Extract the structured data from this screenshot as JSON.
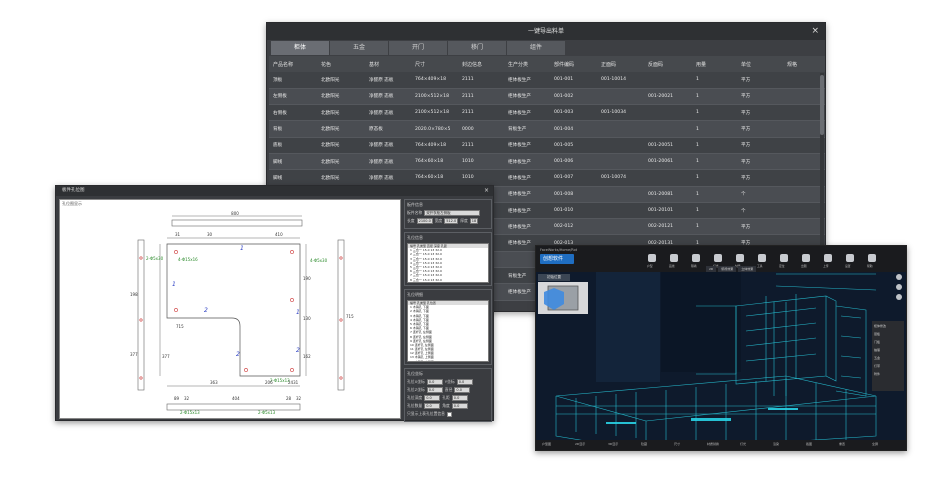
{
  "bom_window": {
    "title": "一键导出料单",
    "close": "×",
    "tabs": [
      "柜体",
      "五金",
      "开门",
      "移门",
      "组件"
    ],
    "columns": [
      "产品名称",
      "花色",
      "基材",
      "尺寸",
      "封边信息",
      "生产分类",
      "部件编码",
      "正面码",
      "反面码",
      "用量",
      "单位",
      "规格"
    ],
    "rows": [
      [
        "顶板",
        "北欧阳光",
        "净醛原 态板",
        "764×409×18",
        "2111",
        "柜体板生产",
        "001-001",
        "001-10014",
        "",
        "1",
        "平方",
        ""
      ],
      [
        "左侧板",
        "北欧阳光",
        "净醛原 态板",
        "2100×512×18",
        "2111",
        "柜体板生产",
        "001-002",
        "",
        "001-20021",
        "1",
        "平方",
        ""
      ],
      [
        "右侧板",
        "北欧阳光",
        "净醛原 态板",
        "2100×512×18",
        "2111",
        "柜体板生产",
        "001-003",
        "001-10034",
        "",
        "1",
        "平方",
        ""
      ],
      [
        "背板",
        "北欧阳光",
        "原态板",
        "2020.0×780×5",
        "0000",
        "背板生产",
        "001-004",
        "",
        "",
        "1",
        "平方",
        ""
      ],
      [
        "底板",
        "北欧阳光",
        "净醛原 态板",
        "764×409×18",
        "2111",
        "柜体板生产",
        "001-005",
        "",
        "001-20051",
        "1",
        "平方",
        ""
      ],
      [
        "脚线",
        "北欧阳光",
        "净醛原 态板",
        "764×60×18",
        "1010",
        "柜体板生产",
        "001-006",
        "",
        "001-20061",
        "1",
        "平方",
        ""
      ],
      [
        "脚线",
        "北欧阳光",
        "净醛原 态板",
        "764×60×18",
        "1010",
        "柜体板生产",
        "001-007",
        "001-10074",
        "",
        "1",
        "平方",
        ""
      ],
      [
        "",
        "",
        "",
        "",
        "",
        "柜体板生产",
        "001-008",
        "",
        "001-20081",
        "1",
        "个",
        ""
      ],
      [
        "",
        "",
        "",
        "",
        "",
        "柜体板生产",
        "001-010",
        "",
        "001-20101",
        "1",
        "个",
        ""
      ],
      [
        "",
        "",
        "",
        "",
        "",
        "柜体板生产",
        "002-012",
        "",
        "002-20121",
        "1",
        "平方",
        ""
      ],
      [
        "",
        "",
        "",
        "",
        "",
        "柜体板生产",
        "002-013",
        "",
        "002-20131",
        "1",
        "平方",
        ""
      ],
      [
        "",
        "",
        "",
        "",
        "",
        "",
        "",
        "",
        "",
        "",
        "",
        ""
      ],
      [
        "",
        "",
        "",
        "",
        "",
        "背板生产",
        "",
        "",
        "",
        "",
        "",
        ""
      ],
      [
        "",
        "",
        "",
        "",
        "",
        "柜体板生产",
        "",
        "",
        "",
        "",
        "",
        ""
      ]
    ]
  },
  "drill_window": {
    "title": "板件孔位图",
    "close": "×",
    "canvas_caption": "孔位图显示",
    "dims": {
      "top_total": "800",
      "top_a": "31",
      "top_b": "30",
      "top_c": "410",
      "left_a": "198",
      "left_b": "715",
      "left_c": "377",
      "right_a": "190",
      "right_b": "130",
      "right_c": "162",
      "bottom_a": "363",
      "bottom_b": "206",
      "bottom_c": "2431",
      "b2_a": "89",
      "b2_b": "32",
      "b2_c": "404",
      "b2_d": "28",
      "b2_e": "32"
    },
    "hole_labels": [
      "2-Φ5x30",
      "4-Φ15x16",
      "4-Φ5x30",
      "2-Φ15x13",
      "2-Φ5x13"
    ],
    "markers": [
      "1",
      "1",
      "1",
      "2",
      "2",
      "2"
    ],
    "panel_info": {
      "group_title": "板件信息",
      "name_label": "板件名称",
      "name_value": "双开衣柜左侧板",
      "len_label": "长度",
      "len_value": "2100.0",
      "wid_label": "宽度",
      "wid_value": "512.0",
      "thk_label": "厚度",
      "thk_value": "18"
    },
    "face_group": {
      "title": "孔位信息",
      "header": "编号  孔类型  直径  深度  孔距",
      "rows": [
        "1  三合一  15.0  13  32.0",
        "2  三合一  15.0  13  32.0",
        "3  三合一  15.0  13  32.0",
        "4  三合一  15.0  13  32.0",
        "5  三合一  15.0  13  32.0",
        "6  三合一  15.0  13  32.0",
        "7  三合一  15.0  13  32.0",
        "8  三合一  15.0  13  32.0"
      ]
    },
    "hole_group": {
      "title": "孔位明细",
      "header": "编号  孔类型  孔位置",
      "rows": [
        "1  木销孔  下面",
        "2  木销孔  下面",
        "3  木销孔  下面",
        "4  木销孔  下面",
        "5  木销孔  下面",
        "6  木销孔  下面",
        "7  连杆孔  左侧面",
        "8  连杆孔  左侧面",
        "9  连杆孔  左侧面",
        "10  连杆孔  左侧面",
        "11  连杆孔  左侧面",
        "12  连杆孔  上侧面",
        "13  木销孔  上侧面",
        "14  木销孔  上侧面"
      ]
    },
    "pos_group": {
      "title": "孔位坐标",
      "rows": [
        {
          "l1": "孔位X坐标",
          "v1": "0.0",
          "l2": "Y坐标",
          "v2": "0.0"
        },
        {
          "l1": "孔位Z坐标",
          "v1": "0.0",
          "l2": "直径",
          "v2": "0.0"
        },
        {
          "l1": "孔位深度",
          "v1": "0.0",
          "l2": "孔距",
          "v2": "0.0"
        },
        {
          "l1": "孔位数量",
          "v1": "0.0",
          "l2": "角度",
          "v2": "0.0"
        }
      ],
      "checkbox_label": "只显示上表孔位置信息"
    }
  },
  "app3d_window": {
    "brand_small": "FaceWorks/Home/Rot",
    "logo": "创想软件",
    "chip": "初始位置",
    "view_tabs": [
      "2D",
      "俯视效果",
      "立体效果"
    ],
    "toolbar": [
      "户型",
      "画线",
      "隔墙",
      "灯光",
      "材质",
      "工具",
      "定位",
      "出图",
      "上传",
      "设置",
      "帮助"
    ],
    "right_panel": [
      "柜体修改",
      "层板",
      "门板",
      "抽屉",
      "五金",
      "灯带",
      "附件"
    ],
    "bottom_bar": [
      "户型图",
      "2D显示",
      "3D显示",
      "隐藏",
      "尺寸",
      "材质替换",
      "灯光",
      "渲染",
      "截图",
      "重置",
      "全屏"
    ],
    "accent": "#1f6ec2",
    "wire_color": "#29d3e6"
  }
}
